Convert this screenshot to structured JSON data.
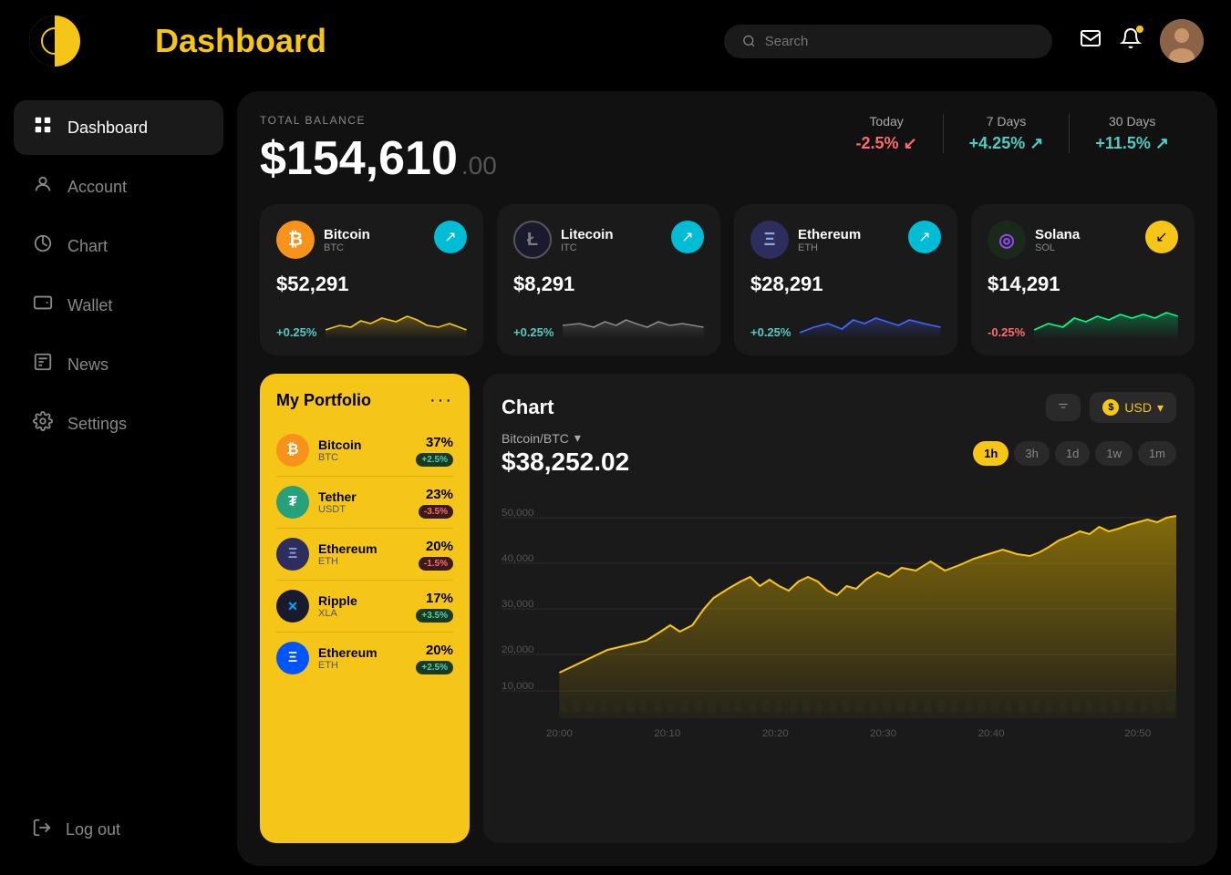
{
  "header": {
    "title": "Dashboard",
    "search_placeholder": "Search"
  },
  "sidebar": {
    "items": [
      {
        "id": "dashboard",
        "label": "Dashboard",
        "icon": "⊞",
        "active": true
      },
      {
        "id": "account",
        "label": "Account",
        "icon": "👤",
        "active": false
      },
      {
        "id": "chart",
        "label": "Chart",
        "icon": "◷",
        "active": false
      },
      {
        "id": "wallet",
        "label": "Wallet",
        "icon": "◻",
        "active": false
      },
      {
        "id": "news",
        "label": "News",
        "icon": "◫",
        "active": false
      },
      {
        "id": "settings",
        "label": "Settings",
        "icon": "⚙",
        "active": false
      }
    ],
    "logout_label": "Log out"
  },
  "balance": {
    "label": "TOTAL BALANCE",
    "main": "$154,610",
    "cents": ".00",
    "stats": [
      {
        "period": "Today",
        "value": "-2.5%",
        "direction": "negative",
        "arrow": "↙"
      },
      {
        "period": "7 Days",
        "value": "+4.25%",
        "direction": "positive",
        "arrow": "↗"
      },
      {
        "period": "30 Days",
        "value": "+11.5%",
        "direction": "positive",
        "arrow": "↗"
      }
    ]
  },
  "crypto_cards": [
    {
      "name": "Bitcoin",
      "ticker": "BTC",
      "price": "$52,291",
      "change": "+0.25%",
      "direction": "positive",
      "arrow_dir": "up",
      "icon_class": "btc",
      "icon_text": "₿"
    },
    {
      "name": "Litecoin",
      "ticker": "ITC",
      "price": "$8,291",
      "change": "+0.25%",
      "direction": "positive",
      "arrow_dir": "up",
      "icon_class": "ltc",
      "icon_text": "Ł"
    },
    {
      "name": "Ethereum",
      "ticker": "ETH",
      "price": "$28,291",
      "change": "+0.25%",
      "direction": "positive",
      "arrow_dir": "up",
      "icon_class": "eth",
      "icon_text": "Ξ"
    },
    {
      "name": "Solana",
      "ticker": "SOL",
      "price": "$14,291",
      "change": "-0.25%",
      "direction": "negative",
      "arrow_dir": "down",
      "icon_class": "sol",
      "icon_text": "◎"
    }
  ],
  "portfolio": {
    "title": "My Portfolio",
    "items": [
      {
        "name": "Bitcoin",
        "ticker": "BTC",
        "pct": "37%",
        "change": "+2.5%",
        "change_dir": "positive",
        "icon_class": "btc",
        "icon_text": "₿"
      },
      {
        "name": "Tether",
        "ticker": "USDT",
        "pct": "23%",
        "change": "-3.5%",
        "change_dir": "negative",
        "icon_class": "usdt",
        "icon_text": "₮"
      },
      {
        "name": "Ethereum",
        "ticker": "ETH",
        "pct": "20%",
        "change": "-1.5%",
        "change_dir": "negative",
        "icon_class": "eth",
        "icon_text": "Ξ"
      },
      {
        "name": "Ripple",
        "ticker": "XLA",
        "pct": "17%",
        "change": "+3.5%",
        "change_dir": "positive",
        "icon_class": "xla",
        "icon_text": "✕"
      },
      {
        "name": "Ethereum",
        "ticker": "ETH",
        "pct": "20%",
        "change": "+2.5%",
        "change_dir": "positive",
        "icon_class": "eth2",
        "icon_text": "Ξ"
      }
    ]
  },
  "chart": {
    "title": "Chart",
    "pair": "Bitcoin/BTC",
    "price": "$38,252.02",
    "currency": "USD",
    "time_buttons": [
      "1h",
      "3h",
      "1d",
      "1w",
      "1m"
    ],
    "active_time": "1h",
    "x_labels": [
      "20:00",
      "20:10",
      "20:20",
      "20:30",
      "20:40",
      "20:50"
    ],
    "y_labels": [
      "50,000",
      "40,000",
      "30,000",
      "20,000",
      "10,000"
    ]
  }
}
